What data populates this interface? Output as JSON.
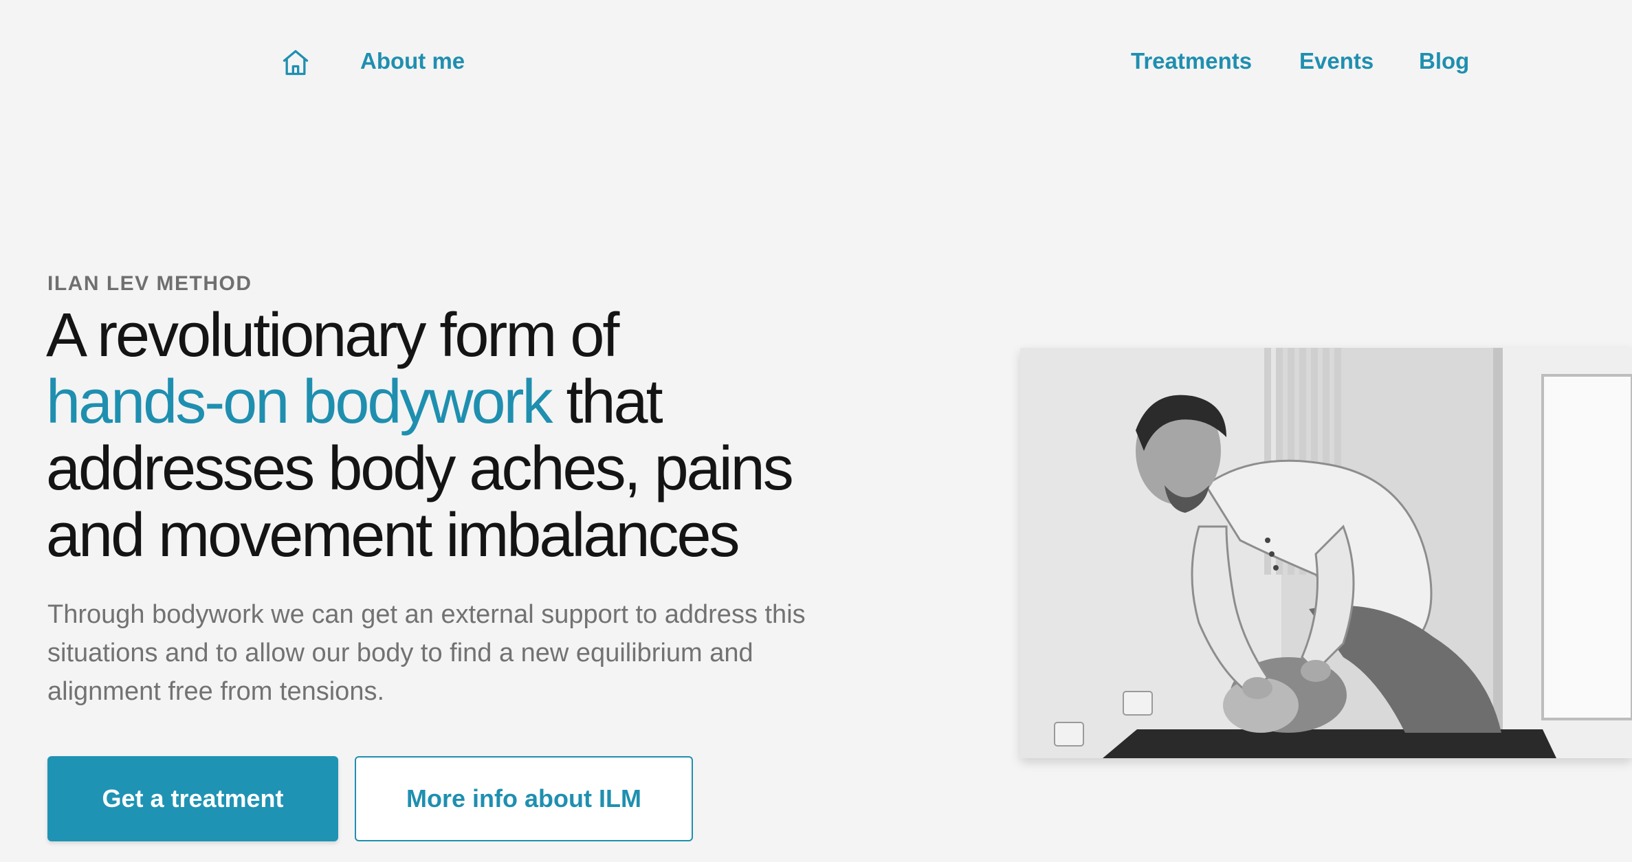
{
  "nav": {
    "home_icon": "home-icon",
    "about": "About me",
    "treatments": "Treatments",
    "events": "Events",
    "blog": "Blog"
  },
  "hero": {
    "eyebrow": "ILAN LEV METHOD",
    "headline_line1": "A revolutionary form of",
    "headline_accent": "hands-on bodywork",
    "headline_rest1": " that",
    "headline_line3": "addresses body aches, pains",
    "headline_line4": "and movement imbalances",
    "subtext": "Through bodywork we can get an external support to address this situations and to allow our body to find a new equilibrium and alignment free from tensions.",
    "primary_button": "Get a treatment",
    "secondary_button": "More info about ILM"
  },
  "colors": {
    "accent": "#1f8fb0",
    "button_bg": "#1f93b4",
    "text_dark": "#141414",
    "text_muted": "#727272",
    "page_bg": "#f4f4f4"
  }
}
